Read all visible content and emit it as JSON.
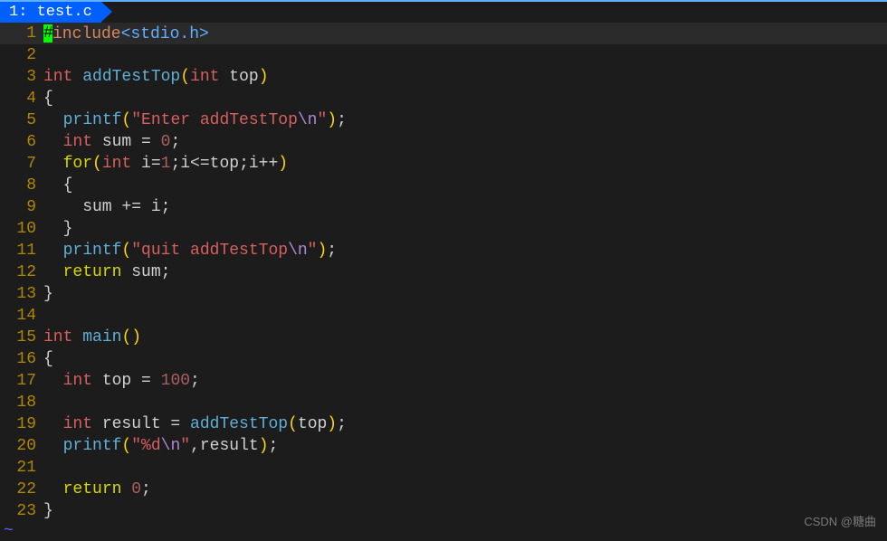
{
  "tab": {
    "label": "1: test.c"
  },
  "lines": [
    {
      "n": "1",
      "tokens": [
        {
          "t": "cursor",
          "v": "#"
        },
        {
          "t": "kw-preproc",
          "v": "include"
        },
        {
          "t": "angle",
          "v": "<stdio.h>"
        }
      ]
    },
    {
      "n": "2",
      "tokens": []
    },
    {
      "n": "3",
      "tokens": [
        {
          "t": "type",
          "v": "int"
        },
        {
          "t": "var",
          "v": " "
        },
        {
          "t": "func",
          "v": "addTestTop"
        },
        {
          "t": "paren",
          "v": "("
        },
        {
          "t": "type",
          "v": "int"
        },
        {
          "t": "var",
          "v": " top"
        },
        {
          "t": "paren",
          "v": ")"
        }
      ]
    },
    {
      "n": "4",
      "tokens": [
        {
          "t": "brace",
          "v": "{"
        }
      ]
    },
    {
      "n": "5",
      "tokens": [
        {
          "t": "var",
          "v": "  "
        },
        {
          "t": "func",
          "v": "printf"
        },
        {
          "t": "paren",
          "v": "("
        },
        {
          "t": "str",
          "v": "\"Enter addTestTop"
        },
        {
          "t": "esc",
          "v": "\\n"
        },
        {
          "t": "str",
          "v": "\""
        },
        {
          "t": "paren",
          "v": ")"
        },
        {
          "t": "semi",
          "v": ";"
        }
      ]
    },
    {
      "n": "6",
      "tokens": [
        {
          "t": "var",
          "v": "  "
        },
        {
          "t": "type",
          "v": "int"
        },
        {
          "t": "var",
          "v": " sum = "
        },
        {
          "t": "num",
          "v": "0"
        },
        {
          "t": "semi",
          "v": ";"
        }
      ]
    },
    {
      "n": "7",
      "tokens": [
        {
          "t": "var",
          "v": "  "
        },
        {
          "t": "kw",
          "v": "for"
        },
        {
          "t": "paren",
          "v": "("
        },
        {
          "t": "type",
          "v": "int"
        },
        {
          "t": "var",
          "v": " i="
        },
        {
          "t": "num",
          "v": "1"
        },
        {
          "t": "var",
          "v": ";i<=top;i++"
        },
        {
          "t": "paren",
          "v": ")"
        }
      ]
    },
    {
      "n": "8",
      "tokens": [
        {
          "t": "var",
          "v": "  "
        },
        {
          "t": "brace",
          "v": "{"
        }
      ]
    },
    {
      "n": "9",
      "tokens": [
        {
          "t": "var",
          "v": "    sum += i"
        },
        {
          "t": "semi",
          "v": ";"
        }
      ]
    },
    {
      "n": "10",
      "tokens": [
        {
          "t": "var",
          "v": "  "
        },
        {
          "t": "brace",
          "v": "}"
        }
      ]
    },
    {
      "n": "11",
      "tokens": [
        {
          "t": "var",
          "v": "  "
        },
        {
          "t": "func",
          "v": "printf"
        },
        {
          "t": "paren",
          "v": "("
        },
        {
          "t": "str",
          "v": "\"quit addTestTop"
        },
        {
          "t": "esc",
          "v": "\\n"
        },
        {
          "t": "str",
          "v": "\""
        },
        {
          "t": "paren",
          "v": ")"
        },
        {
          "t": "semi",
          "v": ";"
        }
      ]
    },
    {
      "n": "12",
      "tokens": [
        {
          "t": "var",
          "v": "  "
        },
        {
          "t": "kw",
          "v": "return"
        },
        {
          "t": "var",
          "v": " sum"
        },
        {
          "t": "semi",
          "v": ";"
        }
      ]
    },
    {
      "n": "13",
      "tokens": [
        {
          "t": "brace",
          "v": "}"
        }
      ]
    },
    {
      "n": "14",
      "tokens": []
    },
    {
      "n": "15",
      "tokens": [
        {
          "t": "type",
          "v": "int"
        },
        {
          "t": "var",
          "v": " "
        },
        {
          "t": "func",
          "v": "main"
        },
        {
          "t": "paren",
          "v": "()"
        }
      ]
    },
    {
      "n": "16",
      "tokens": [
        {
          "t": "brace",
          "v": "{"
        }
      ]
    },
    {
      "n": "17",
      "tokens": [
        {
          "t": "var",
          "v": "  "
        },
        {
          "t": "type",
          "v": "int"
        },
        {
          "t": "var",
          "v": " top = "
        },
        {
          "t": "num",
          "v": "100"
        },
        {
          "t": "semi",
          "v": ";"
        }
      ]
    },
    {
      "n": "18",
      "tokens": []
    },
    {
      "n": "19",
      "tokens": [
        {
          "t": "var",
          "v": "  "
        },
        {
          "t": "type",
          "v": "int"
        },
        {
          "t": "var",
          "v": " result = "
        },
        {
          "t": "func",
          "v": "addTestTop"
        },
        {
          "t": "paren",
          "v": "("
        },
        {
          "t": "var",
          "v": "top"
        },
        {
          "t": "paren",
          "v": ")"
        },
        {
          "t": "semi",
          "v": ";"
        }
      ]
    },
    {
      "n": "20",
      "tokens": [
        {
          "t": "var",
          "v": "  "
        },
        {
          "t": "func",
          "v": "printf"
        },
        {
          "t": "paren",
          "v": "("
        },
        {
          "t": "str",
          "v": "\"%d"
        },
        {
          "t": "esc",
          "v": "\\n"
        },
        {
          "t": "str",
          "v": "\""
        },
        {
          "t": "var",
          "v": ",result"
        },
        {
          "t": "paren",
          "v": ")"
        },
        {
          "t": "semi",
          "v": ";"
        }
      ]
    },
    {
      "n": "21",
      "tokens": []
    },
    {
      "n": "22",
      "tokens": [
        {
          "t": "var",
          "v": "  "
        },
        {
          "t": "kw",
          "v": "return"
        },
        {
          "t": "var",
          "v": " "
        },
        {
          "t": "num",
          "v": "0"
        },
        {
          "t": "semi",
          "v": ";"
        }
      ]
    },
    {
      "n": "23",
      "tokens": [
        {
          "t": "brace",
          "v": "}"
        }
      ]
    }
  ],
  "watermark": "CSDN @糖曲",
  "tilde": "~"
}
